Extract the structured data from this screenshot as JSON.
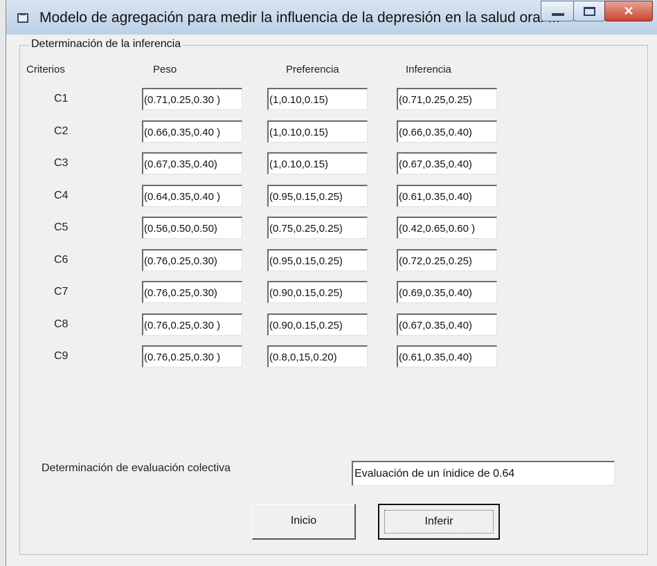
{
  "window": {
    "title": "Modelo de agregación para medir la influencia de la depresión  en la salud oral ..."
  },
  "frame": {
    "legend": "Determinación de la  inferencia"
  },
  "table": {
    "headers": [
      "Criterios",
      "Peso",
      "Preferencia",
      "Inferencia"
    ],
    "rows": [
      {
        "criterio": "C1",
        "peso": "(0.71,0.25,0.30 )",
        "preferencia": "(1,0.10,0.15)",
        "inferencia": "(0.71,0.25,0.25)"
      },
      {
        "criterio": "C2",
        "peso": "(0.66,0.35,0.40 )",
        "preferencia": "(1,0.10,0.15)",
        "inferencia": "(0.66,0.35,0.40)"
      },
      {
        "criterio": "C3",
        "peso": "(0.67,0.35,0.40)",
        "preferencia": "(1,0.10,0.15)",
        "inferencia": "(0.67,0.35,0.40)"
      },
      {
        "criterio": "C4",
        "peso": "(0.64,0.35,0.40 )",
        "preferencia": "(0.95,0.15,0.25)",
        "inferencia": "(0.61,0.35,0.40)"
      },
      {
        "criterio": "C5",
        "peso": "(0.56,0.50,0.50)",
        "preferencia": "(0.75,0.25,0.25)",
        "inferencia": "(0.42,0.65,0.60 )"
      },
      {
        "criterio": "C6",
        "peso": "(0.76,0.25,0.30)",
        "preferencia": "(0.95,0.15,0.25)",
        "inferencia": "(0.72,0.25,0.25)"
      },
      {
        "criterio": "C7",
        "peso": "(0.76,0.25,0.30)",
        "preferencia": "(0.90,0.15,0.25)",
        "inferencia": "(0.69,0.35,0.40)"
      },
      {
        "criterio": "C8",
        "peso": "(0.76,0.25,0.30 )",
        "preferencia": "(0.90,0.15,0.25)",
        "inferencia": "(0.67,0.35,0.40)"
      },
      {
        "criterio": "C9",
        "peso": "(0.76,0.25,0.30 )",
        "preferencia": "(0.8,0,15,0.20)",
        "inferencia": "(0.61,0.35,0.40)"
      }
    ]
  },
  "evaluation": {
    "label": "Determinación de evaluación colectiva",
    "value": "Evaluación de un ínidice de 0.64"
  },
  "buttons": {
    "inicio": "Inicio",
    "inferir": "Inferir"
  },
  "icons": [
    "app-icon",
    "minimize-icon",
    "maximize-icon",
    "close-icon"
  ]
}
